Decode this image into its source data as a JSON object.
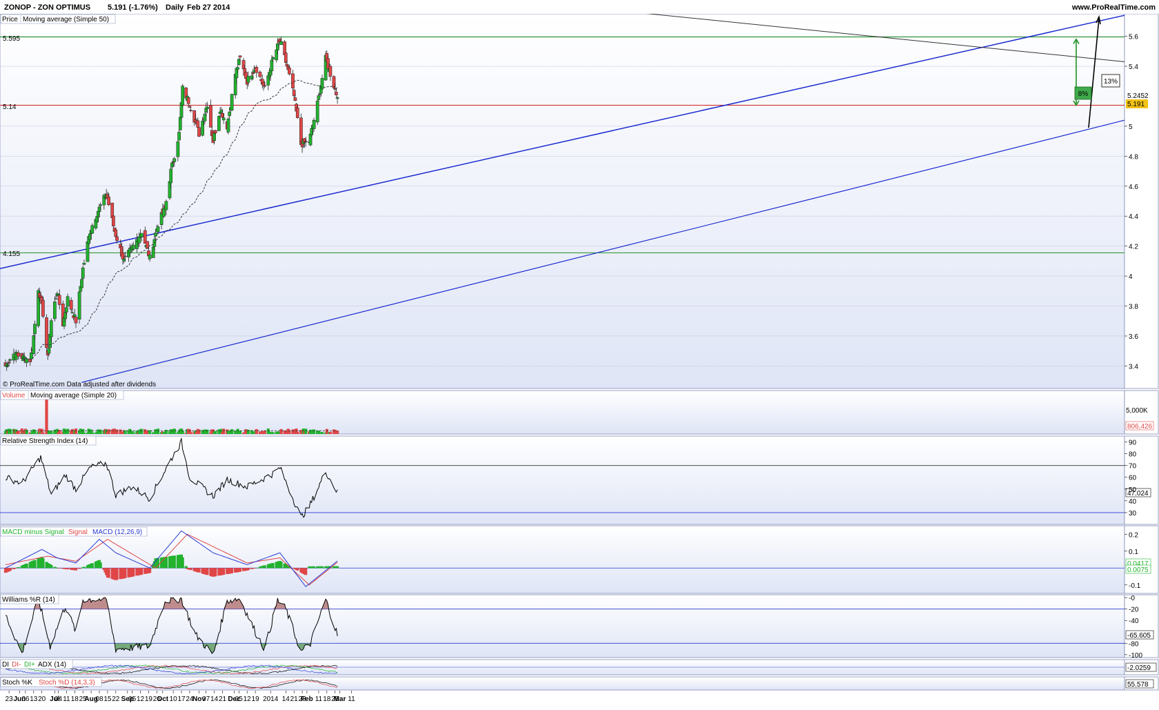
{
  "header": {
    "symbol": "ZONOP - ZON OPTIMUS",
    "quote": "5.191 (-1.76%)",
    "interval": "Daily",
    "date": "Feb 27 2014",
    "site": "www.ProRealTime.com"
  },
  "colors": {
    "background": "#e8ecf8",
    "up_candle": "#22b22e",
    "down_candle": "#e04646",
    "trend_line": "#1a2ad0",
    "support_line": "#1e8f1e",
    "resistance_line": "#d21e1e",
    "macd_line": "#2a3ad4",
    "signal_line": "#e04646",
    "williams_overbought": "#b07070",
    "williams_oversold": "#5a9a5a"
  },
  "chart_data": [
    {
      "type": "candlestick",
      "panel": "price",
      "title": "Price",
      "indicator_label": "Moving average (Simple 50)",
      "x_tick_labels": [
        "23",
        "Jun",
        "06",
        "13",
        "20",
        "Jul",
        "04",
        "11",
        "18",
        "25",
        "Aug",
        "08",
        "15",
        "22",
        "Sep",
        "05",
        "12",
        "19",
        "26",
        "Oct",
        "10",
        "17",
        "24",
        "Nov",
        "07",
        "14",
        "21",
        "Dec",
        "05",
        "12",
        "19",
        "2014",
        "14",
        "21",
        "28",
        "Feb",
        "11",
        "18",
        "25",
        "Mar",
        "11"
      ],
      "y_tick_labels": [
        "5.6",
        "5.4",
        "5",
        "4.8",
        "4.6",
        "4.4",
        "4.2",
        "4",
        "3.8",
        "3.6",
        "3.4"
      ],
      "ylim": [
        3.25,
        5.75
      ],
      "close_anchors": [
        {
          "date": "2013-05-20",
          "close": 3.4
        },
        {
          "date": "2013-05-27",
          "close": 3.48
        },
        {
          "date": "2013-06-03",
          "close": 3.46
        },
        {
          "date": "2013-06-10",
          "close": 3.44
        },
        {
          "date": "2013-06-12",
          "close": 3.52
        },
        {
          "date": "2013-06-17",
          "close": 3.92
        },
        {
          "date": "2013-06-21",
          "close": 3.75
        },
        {
          "date": "2013-06-25",
          "close": 3.45
        },
        {
          "date": "2013-06-28",
          "close": 3.7
        },
        {
          "date": "2013-07-03",
          "close": 3.9
        },
        {
          "date": "2013-07-08",
          "close": 3.68
        },
        {
          "date": "2013-07-12",
          "close": 3.85
        },
        {
          "date": "2013-07-19",
          "close": 3.7
        },
        {
          "date": "2013-07-25",
          "close": 4.05
        },
        {
          "date": "2013-07-31",
          "close": 4.3
        },
        {
          "date": "2013-08-06",
          "close": 4.42
        },
        {
          "date": "2013-08-14",
          "close": 4.55
        },
        {
          "date": "2013-08-21",
          "close": 4.3
        },
        {
          "date": "2013-08-29",
          "close": 4.1
        },
        {
          "date": "2013-09-06",
          "close": 4.2
        },
        {
          "date": "2013-09-13",
          "close": 4.3
        },
        {
          "date": "2013-09-20",
          "close": 4.12
        },
        {
          "date": "2013-09-27",
          "close": 4.35
        },
        {
          "date": "2013-10-03",
          "close": 4.45
        },
        {
          "date": "2013-10-08",
          "close": 4.7
        },
        {
          "date": "2013-10-15",
          "close": 4.95
        },
        {
          "date": "2013-10-18",
          "close": 5.25
        },
        {
          "date": "2013-10-24",
          "close": 5.15
        },
        {
          "date": "2013-11-01",
          "close": 4.95
        },
        {
          "date": "2013-11-08",
          "close": 5.15
        },
        {
          "date": "2013-11-13",
          "close": 4.9
        },
        {
          "date": "2013-11-19",
          "close": 5.12
        },
        {
          "date": "2013-11-25",
          "close": 5.0
        },
        {
          "date": "2013-12-02",
          "close": 5.35
        },
        {
          "date": "2013-12-06",
          "close": 5.45
        },
        {
          "date": "2013-12-12",
          "close": 5.3
        },
        {
          "date": "2013-12-19",
          "close": 5.4
        },
        {
          "date": "2013-12-27",
          "close": 5.25
        },
        {
          "date": "2014-01-03",
          "close": 5.45
        },
        {
          "date": "2014-01-09",
          "close": 5.57
        },
        {
          "date": "2014-01-15",
          "close": 5.4
        },
        {
          "date": "2014-01-21",
          "close": 5.2
        },
        {
          "date": "2014-01-27",
          "close": 4.88
        },
        {
          "date": "2014-02-03",
          "close": 4.9
        },
        {
          "date": "2014-02-10",
          "close": 5.15
        },
        {
          "date": "2014-02-17",
          "close": 5.45
        },
        {
          "date": "2014-02-21",
          "close": 5.35
        },
        {
          "date": "2014-02-27",
          "close": 5.191
        }
      ],
      "moving_average_last": 5.2452,
      "last_price": 5.191,
      "horizontal_levels": [
        {
          "label": "5.595",
          "value": 5.595
        },
        {
          "label": "5.14",
          "value": 5.14
        },
        {
          "label": "4.155",
          "value": 4.155
        }
      ],
      "annotations": [
        {
          "text": "8%",
          "arrow": "target up"
        },
        {
          "text": "13%",
          "arrow": "channel width"
        }
      ],
      "last_labels": [
        "5.2452",
        "5.191"
      ],
      "footer_note": "© ProRealTime.com Data adjusted after dividends"
    },
    {
      "type": "bar",
      "panel": "volume",
      "title": "Volume",
      "indicator_label": "Moving average (Simple 20)",
      "y_tick_labels": [
        "5,000K"
      ],
      "last_value_label": "806,426",
      "typical_volume_k": 450,
      "spike_volume_k": 5600,
      "ylim_k": [
        0,
        6000
      ]
    },
    {
      "type": "line",
      "panel": "rsi",
      "title": "Relative Strength Index (14)",
      "y_tick_labels": [
        "90",
        "80",
        "70",
        "60",
        "50",
        "40",
        "30"
      ],
      "ylim": [
        20,
        95
      ],
      "levels": [
        70,
        30
      ],
      "anchors": [
        {
          "date": "2013-05-20",
          "value": 60
        },
        {
          "date": "2013-06-03",
          "value": 55
        },
        {
          "date": "2013-06-19",
          "value": 77
        },
        {
          "date": "2013-06-28",
          "value": 45
        },
        {
          "date": "2013-07-10",
          "value": 62
        },
        {
          "date": "2013-07-19",
          "value": 50
        },
        {
          "date": "2013-07-31",
          "value": 68
        },
        {
          "date": "2013-08-14",
          "value": 72
        },
        {
          "date": "2013-08-22",
          "value": 45
        },
        {
          "date": "2013-09-05",
          "value": 52
        },
        {
          "date": "2013-09-20",
          "value": 42
        },
        {
          "date": "2013-10-08",
          "value": 75
        },
        {
          "date": "2013-10-17",
          "value": 90
        },
        {
          "date": "2013-10-24",
          "value": 60
        },
        {
          "date": "2013-11-13",
          "value": 44
        },
        {
          "date": "2013-11-25",
          "value": 58
        },
        {
          "date": "2013-12-12",
          "value": 52
        },
        {
          "date": "2014-01-03",
          "value": 63
        },
        {
          "date": "2014-01-09",
          "value": 68
        },
        {
          "date": "2014-01-27",
          "value": 26
        },
        {
          "date": "2014-02-03",
          "value": 35
        },
        {
          "date": "2014-02-17",
          "value": 65
        },
        {
          "date": "2014-02-27",
          "value": 47.024
        }
      ],
      "last_value_label": "47.024"
    },
    {
      "type": "bar+line",
      "panel": "macd",
      "title": "MACD minus Signal",
      "legend": [
        "MACD minus Signal",
        "Signal",
        "MACD (12,26,9)"
      ],
      "y_tick_labels": [
        "0.2",
        "0.1",
        "-0.1"
      ],
      "ylim": [
        -0.15,
        0.25
      ],
      "macd_anchors": [
        {
          "date": "2013-05-20",
          "value": 0.0
        },
        {
          "date": "2013-06-20",
          "value": 0.11
        },
        {
          "date": "2013-07-03",
          "value": 0.06
        },
        {
          "date": "2013-07-19",
          "value": 0.03
        },
        {
          "date": "2013-08-08",
          "value": 0.17
        },
        {
          "date": "2013-08-22",
          "value": 0.09
        },
        {
          "date": "2013-09-20",
          "value": 0.0
        },
        {
          "date": "2013-10-17",
          "value": 0.22
        },
        {
          "date": "2013-11-13",
          "value": 0.09
        },
        {
          "date": "2013-12-12",
          "value": 0.02
        },
        {
          "date": "2014-01-09",
          "value": 0.09
        },
        {
          "date": "2014-01-31",
          "value": -0.11
        },
        {
          "date": "2014-02-27",
          "value": 0.0417
        }
      ],
      "signal_anchors": [
        {
          "date": "2013-05-20",
          "value": 0.02
        },
        {
          "date": "2013-06-25",
          "value": 0.07
        },
        {
          "date": "2013-07-19",
          "value": 0.04
        },
        {
          "date": "2013-08-15",
          "value": 0.17
        },
        {
          "date": "2013-09-25",
          "value": 0.0
        },
        {
          "date": "2013-10-22",
          "value": 0.2
        },
        {
          "date": "2013-12-12",
          "value": 0.03
        },
        {
          "date": "2014-01-09",
          "value": 0.06
        },
        {
          "date": "2014-02-03",
          "value": -0.1
        },
        {
          "date": "2014-02-27",
          "value": 0.034
        }
      ],
      "last_value_labels": [
        "0.0417",
        "0.0075"
      ]
    },
    {
      "type": "line",
      "panel": "williams",
      "title": "Williams %R (14)",
      "y_tick_labels": [
        "-0",
        "-20",
        "-40",
        "-65.605",
        "-80",
        "-100"
      ],
      "ylim": [
        -105,
        5
      ],
      "levels": [
        -20,
        -80
      ],
      "anchors": [
        {
          "date": "2013-05-20",
          "value": -30
        },
        {
          "date": "2013-06-03",
          "value": -98
        },
        {
          "date": "2013-06-17",
          "value": -2
        },
        {
          "date": "2013-06-27",
          "value": -85
        },
        {
          "date": "2013-07-10",
          "value": -15
        },
        {
          "date": "2013-07-19",
          "value": -60
        },
        {
          "date": "2013-07-25",
          "value": -3
        },
        {
          "date": "2013-08-14",
          "value": -3
        },
        {
          "date": "2013-08-22",
          "value": -90
        },
        {
          "date": "2013-09-20",
          "value": -85
        },
        {
          "date": "2013-10-03",
          "value": -5
        },
        {
          "date": "2013-10-17",
          "value": -2
        },
        {
          "date": "2013-10-29",
          "value": -65
        },
        {
          "date": "2013-11-13",
          "value": -100
        },
        {
          "date": "2013-11-25",
          "value": -5
        },
        {
          "date": "2013-12-06",
          "value": -2
        },
        {
          "date": "2013-12-19",
          "value": -60
        },
        {
          "date": "2013-12-27",
          "value": -90
        },
        {
          "date": "2014-01-07",
          "value": -5
        },
        {
          "date": "2014-01-14",
          "value": -20
        },
        {
          "date": "2014-01-27",
          "value": -95
        },
        {
          "date": "2014-02-04",
          "value": -80
        },
        {
          "date": "2014-02-17",
          "value": -3
        },
        {
          "date": "2014-02-27",
          "value": -65.605
        }
      ],
      "last_value_label": "-65.605"
    },
    {
      "type": "line",
      "panel": "adx",
      "title": "DI",
      "legend": [
        "DI",
        "DI-",
        "DI+",
        "ADX (14)"
      ],
      "last_value_label": "-2.0259"
    },
    {
      "type": "line",
      "panel": "stochastic",
      "title": "Stoch %K",
      "legend": [
        "Stoch %K",
        "Stoch %D (14,3,3)"
      ],
      "last_value_label": "55.578"
    }
  ]
}
